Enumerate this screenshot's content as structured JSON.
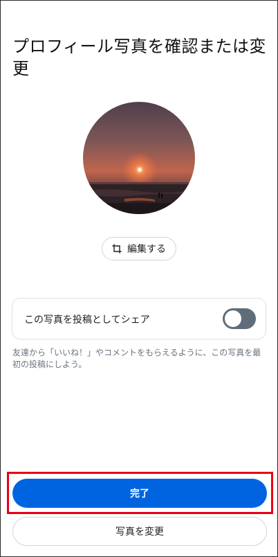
{
  "page": {
    "title": "プロフィール写真を確認または変更"
  },
  "profile_photo": {
    "alt": "sunset-over-sea"
  },
  "edit_button": {
    "label": "編集する",
    "icon": "crop-icon"
  },
  "share_option": {
    "label": "この写真を投稿としてシェア",
    "enabled": false
  },
  "hint": {
    "text": "友達から「いいね！」やコメントをもらえるように、この写真を最初の投稿にしよう。"
  },
  "actions": {
    "done_label": "完了",
    "change_label": "写真を変更"
  },
  "colors": {
    "primary": "#0064e0",
    "highlight": "#e60012",
    "toggle_off": "#5f6d7a"
  }
}
